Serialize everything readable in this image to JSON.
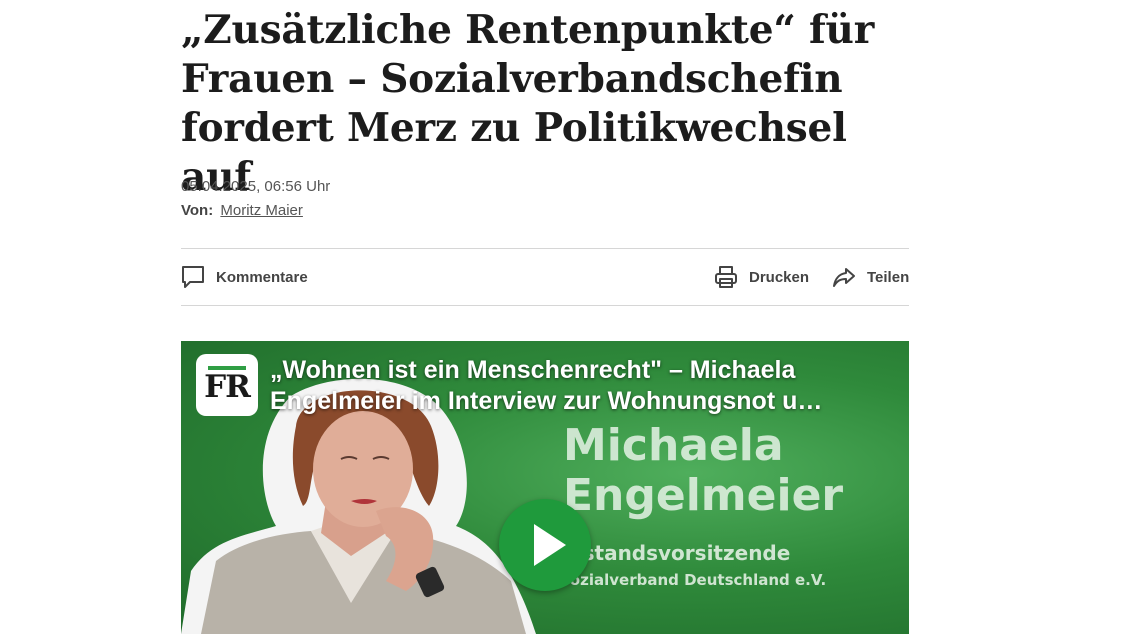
{
  "article": {
    "headline": "„Zusätzliche Rentenpunkte“ für Frauen – Sozialverbandschefin fordert Merz zu Politikwechsel auf",
    "date": "05.04.2025, 06:56 Uhr",
    "byline_label": "Von:",
    "author": "Moritz Maier"
  },
  "actions": {
    "comments": "Kommentare",
    "print": "Drucken",
    "share": "Teilen"
  },
  "video": {
    "logo_text": "FR",
    "title": "„Wohnen ist ein Menschenrecht\" – Michaela Engelmeier im Interview zur Wohnungsnot u…",
    "overlay_name_line1": "Michaela",
    "overlay_name_line2": "Engelmeier",
    "overlay_role": "orstandsvorsitzende",
    "overlay_org": "Sozialverband Deutschland e.V."
  },
  "colors": {
    "video_green": "#2f8a3b",
    "play_button": "#1f9a3c",
    "logo_accent": "#2f9e44"
  }
}
